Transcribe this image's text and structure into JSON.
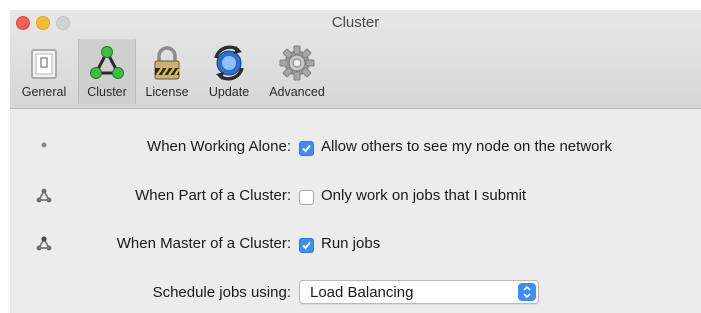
{
  "window": {
    "title": "Cluster"
  },
  "toolbar": {
    "tabs": [
      {
        "label": "General",
        "icon": "general-icon"
      },
      {
        "label": "Cluster",
        "icon": "cluster-icon",
        "selected": true
      },
      {
        "label": "License",
        "icon": "lock-icon"
      },
      {
        "label": "Update",
        "icon": "update-icon"
      },
      {
        "label": "Advanced",
        "icon": "gear-icon"
      }
    ]
  },
  "settings": {
    "working_alone": {
      "label": "When Working Alone:",
      "option": "Allow others to see my node on the network",
      "checked": true
    },
    "part_of_cluster": {
      "label": "When Part of a Cluster:",
      "option": "Only work on jobs that I submit",
      "checked": false
    },
    "master_of_cluster": {
      "label": "When Master of a Cluster:",
      "option": "Run jobs",
      "checked": true
    },
    "schedule": {
      "label": "Schedule jobs using:",
      "value": "Load Balancing"
    }
  },
  "colors": {
    "accent": "#3d8ef7",
    "cluster_green": "#3fbf3f"
  }
}
